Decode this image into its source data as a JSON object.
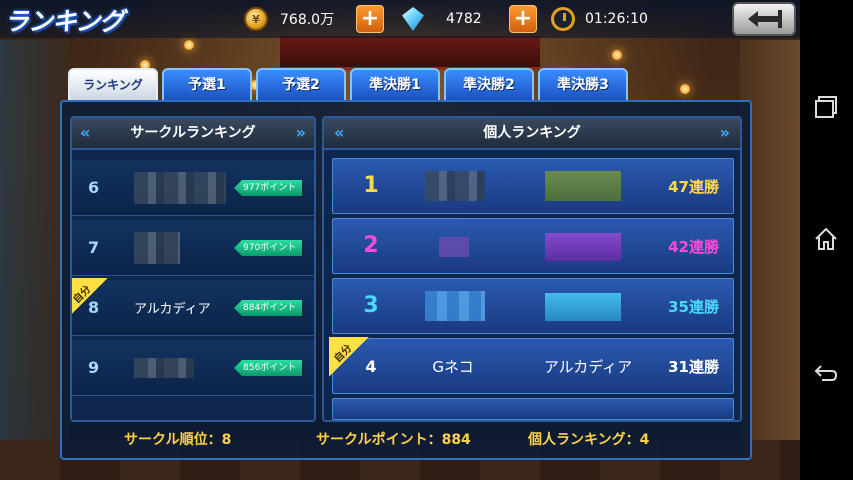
{
  "header": {
    "title": "ランキング",
    "coins": "768.0万",
    "gems": "4782",
    "timer": "01:26:10",
    "icons": {
      "coin": "coin-icon",
      "gem": "gem-icon",
      "clock": "clock-icon",
      "back": "back-arrow-icon"
    }
  },
  "tabs": [
    {
      "label": "ランキング",
      "active": true
    },
    {
      "label": "予選1",
      "active": false
    },
    {
      "label": "予選2",
      "active": false
    },
    {
      "label": "準決勝1",
      "active": false
    },
    {
      "label": "準決勝2",
      "active": false
    },
    {
      "label": "準決勝3",
      "active": false
    }
  ],
  "circle_ranking": {
    "header": "サークルランキング",
    "self_badge": "自分",
    "rows": [
      {
        "rank": "6",
        "name": "",
        "points": "977ポイント",
        "is_self": false
      },
      {
        "rank": "7",
        "name": "",
        "points": "970ポイント",
        "is_self": false
      },
      {
        "rank": "8",
        "name": "アルカディア",
        "points": "884ポイント",
        "is_self": true
      },
      {
        "rank": "9",
        "name": "",
        "points": "856ポイント",
        "is_self": false
      }
    ]
  },
  "individual_ranking": {
    "header": "個人ランキング",
    "self_badge": "自分",
    "rows": [
      {
        "rank": "1",
        "player": "",
        "circle": "",
        "wins": "47連勝",
        "color": "#ffd84a"
      },
      {
        "rank": "2",
        "player": "",
        "circle": "",
        "wins": "42連勝",
        "color": "#ff4ad8"
      },
      {
        "rank": "3",
        "player": "",
        "circle": "",
        "wins": "35連勝",
        "color": "#4ad8ff"
      },
      {
        "rank": "4",
        "player": "Gネコ",
        "circle": "アルカディア",
        "wins": "31連勝",
        "color": "#ffffff"
      }
    ]
  },
  "footer": {
    "circle_rank": "サークル順位：8",
    "circle_points": "サークルポイント：884",
    "individual_rank": "個人ランキング：4"
  },
  "colors": {
    "accent": "#ffd24a",
    "plus": "#ff9a30",
    "tab": "#1a4fba"
  }
}
